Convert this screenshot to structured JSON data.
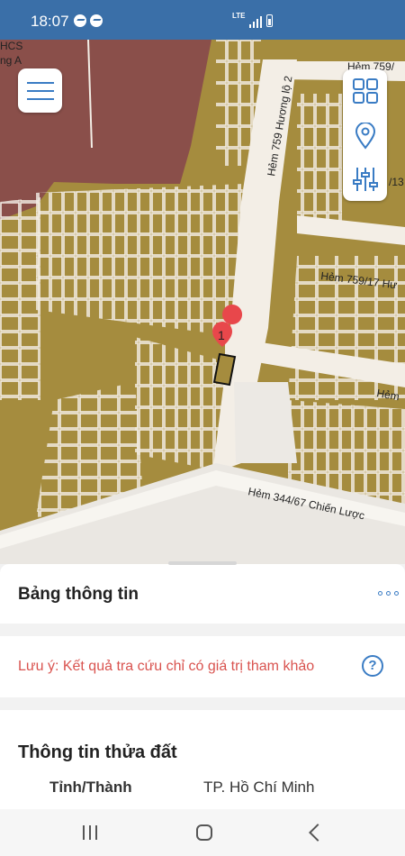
{
  "status_bar": {
    "time": "18:07",
    "network": "LTE",
    "icons": [
      "messenger-icon",
      "messenger-icon",
      "signal-icon",
      "battery-icon"
    ]
  },
  "map": {
    "parcel_marker": "1",
    "labels": {
      "school_line1": "HCS",
      "school_line2": "ng A",
      "road_huong_lo": "Hẻm 759 Hương lộ 2",
      "road_759_top": "Hẻm 759/",
      "road_759_right": "/13",
      "road_759_17": "Hẻm 759/17 Hư",
      "road_hem_right": "Hẻm",
      "road_chien_luoc": "Hẻm 344/67 Chiến Lược"
    },
    "colors": {
      "land": "#a58c3e",
      "road": "#f3eee6",
      "institution": "#8a4f4a",
      "accent": "#3a7cc4",
      "marker": "#e8474b"
    }
  },
  "toolbar": {
    "menu_icon": "hamburger-icon",
    "tools": [
      "grid-icon",
      "location-pin-icon",
      "sliders-icon"
    ]
  },
  "sheet": {
    "title": "Bảng thông tin",
    "more_icon": "more-icon",
    "note": "Lưu ý: Kết quả tra cứu chỉ có giá trị tham khảo",
    "help_icon_text": "?",
    "parcel": {
      "section_title": "Thông tin thửa đất",
      "province_label": "Tỉnh/Thành",
      "province_value": "TP. Hồ Chí Minh"
    }
  },
  "nav": {
    "items": [
      "recent-apps",
      "home",
      "back"
    ]
  }
}
